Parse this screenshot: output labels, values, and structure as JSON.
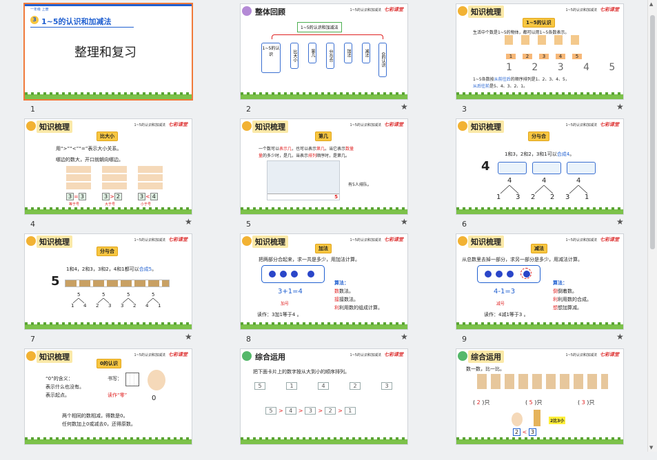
{
  "slides": [
    {
      "num": "1",
      "lesson_no": "3",
      "title": "1~5的认识和加减法",
      "subtitle": "整理和复习",
      "top_label": "一年级 上册"
    },
    {
      "num": "2",
      "header": "整体回顾",
      "course": "1~5的认识和加减法",
      "logo": "七彩课堂",
      "root": "1~5的认识和加减法",
      "items": [
        "1~5的认识",
        "比大小",
        "第几",
        "分与合",
        "加法",
        "减法",
        "0的认识"
      ]
    },
    {
      "num": "3",
      "header": "知识梳理",
      "course": "1~5的认识和加减法",
      "logo": "七彩课堂",
      "tag": "1~5的认识",
      "line1": "生活中个数是1~5的物体，都可以用1~5各数表示。",
      "digits": [
        "1",
        "2",
        "3",
        "4",
        "5"
      ],
      "line2a": "1~5各数按",
      "line2b": "从前往后",
      "line2c": "的顺序排列是1、2、3、4、5，",
      "line3a": "从后往前",
      "line3b": "是5、4、3、2、1。"
    },
    {
      "num": "4",
      "header": "知识梳理",
      "course": "1~5的认识和加减法",
      "logo": "七彩课堂",
      "tag": "比大小",
      "line1": "用“>”“<”“=”表示大小关系。",
      "line2": "哪边的数大，开口就朝向哪边。",
      "compare": [
        {
          "a": "3",
          "op": "=",
          "b": "3",
          "note": "等于号"
        },
        {
          "a": "3",
          "op": ">",
          "b": "2",
          "note": "大于号"
        },
        {
          "a": "3",
          "op": "<",
          "b": "4",
          "note": "小于号"
        }
      ]
    },
    {
      "num": "5",
      "header": "知识梳理",
      "course": "1~5的认识和加减法",
      "logo": "七彩课堂",
      "tag": "第几",
      "line1a": "一个数可以",
      "line1b": "表示几",
      "line1c": "，也可以表示",
      "line1d": "第几",
      "line1e": "。当它表示",
      "line1f": "数量",
      "line2a": "量",
      "line2b": "的多少时，是几，当表示",
      "line2c": "排列",
      "line2d": "顺序时，是第几。",
      "note": "有5人排队。",
      "pos": "5"
    },
    {
      "num": "6",
      "header": "知识梳理",
      "course": "1~5的认识和加减法",
      "logo": "七彩课堂",
      "tag": "分与合",
      "line1a": "1和3，2和2，3和1可以",
      "line1b": "合成4",
      "line1c": "。",
      "big": "4",
      "splits": [
        {
          "top": "4",
          "l": "1",
          "r": "3"
        },
        {
          "top": "4",
          "l": "2",
          "r": "2"
        },
        {
          "top": "4",
          "l": "3",
          "r": "1"
        }
      ]
    },
    {
      "num": "7",
      "header": "知识梳理",
      "course": "1~5的认识和加减法",
      "logo": "七彩课堂",
      "tag": "分与合",
      "line1a": "1和4，2和3，3和2，4和1都可以",
      "line1b": "合成5",
      "line1c": "。",
      "big": "5",
      "splits": [
        {
          "top": "5",
          "l": "1",
          "r": "4"
        },
        {
          "top": "5",
          "l": "2",
          "r": "3"
        },
        {
          "top": "5",
          "l": "3",
          "r": "2"
        },
        {
          "top": "5",
          "l": "4",
          "r": "1"
        }
      ]
    },
    {
      "num": "8",
      "header": "知识梳理",
      "course": "1~5的认识和加减法",
      "logo": "七彩课堂",
      "tag": "加法",
      "line1": "把两部分合起来，求一共是多少，用加法计算。",
      "eq": "3+1=4",
      "sign": "加号",
      "read": "读作：3加1等于4 。",
      "alg_title": "算法：",
      "alg": [
        {
          "k": "数",
          "v": "数法。"
        },
        {
          "k": "接",
          "v": "接数法。"
        },
        {
          "k": "利",
          "v": "利用数的组成计算。"
        }
      ]
    },
    {
      "num": "9",
      "header": "知识梳理",
      "course": "1~5的认识和加减法",
      "logo": "七彩课堂",
      "tag": "减法",
      "line1": "从总数里去掉一部分，求另一部分是多少，用减法计算。",
      "eq": "4-1=3",
      "sign": "减号",
      "read": "读作：4减1等于3 。",
      "alg_title": "算法：",
      "alg": [
        {
          "k": "倒",
          "v": "倒着数。"
        },
        {
          "k": "利",
          "v": "利用数的合成。"
        },
        {
          "k": "想",
          "v": "想加算减。"
        }
      ]
    },
    {
      "num": "10",
      "header": "知识梳理",
      "course": "1~5的认识和加减法",
      "logo": "七彩课堂",
      "tag": "0的认识",
      "q": "“0”的含义：",
      "m1": "表示什么也没有。",
      "m2": "表示起点。",
      "write": "书写：",
      "read": "读作“零”",
      "zero": "0",
      "l1": "两个相同的数相减，得数是0。",
      "l2": "任何数加上0或减去0，还得原数。"
    },
    {
      "num": "11",
      "header": "综合运用",
      "course": "1~5的认识和加减法",
      "logo": "七彩课堂",
      "line1": "把下面卡片上的数字按从大到小的顺序排列。",
      "cards": [
        "5",
        "1",
        "4",
        "2",
        "3"
      ],
      "sorted": [
        "5",
        "4",
        "3",
        "2",
        "1"
      ],
      "op": ">"
    },
    {
      "num": "12",
      "header": "综合运用",
      "course": "1~5的认识和加减法",
      "logo": "七彩课堂",
      "line1": "数一数，比一比。",
      "counts": [
        "2",
        "5",
        "3"
      ],
      "unit": "只",
      "hint": "2比3小",
      "cmp": {
        "a": "2",
        "op": "<",
        "b": "3"
      }
    }
  ]
}
